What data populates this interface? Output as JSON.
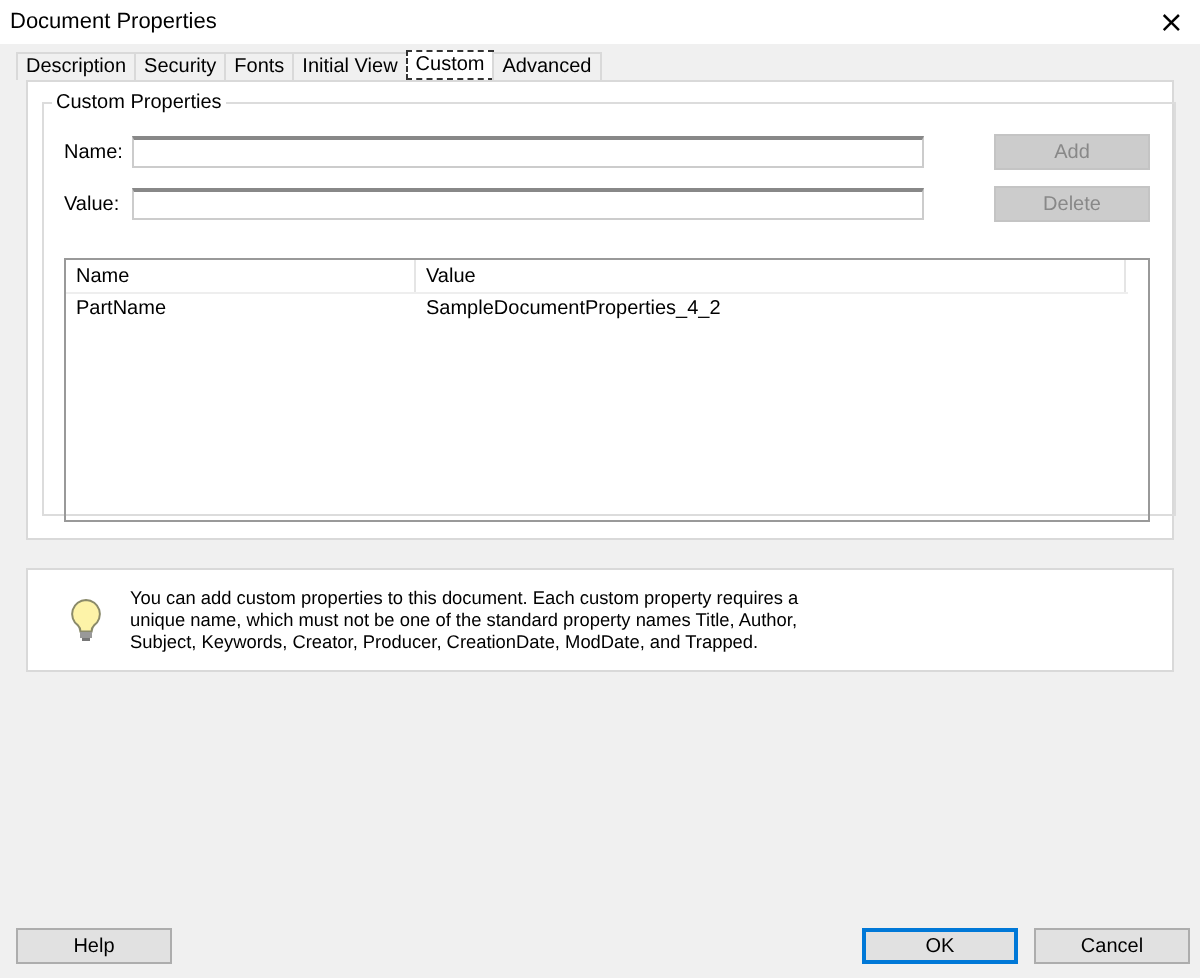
{
  "window": {
    "title": "Document Properties",
    "close": "×"
  },
  "tabs": [
    {
      "label": "Description",
      "selected": false
    },
    {
      "label": "Security",
      "selected": false
    },
    {
      "label": "Fonts",
      "selected": false
    },
    {
      "label": "Initial View",
      "selected": false
    },
    {
      "label": "Custom",
      "selected": true
    },
    {
      "label": "Advanced",
      "selected": false
    }
  ],
  "group": {
    "title": "Custom Properties",
    "fields": [
      {
        "label": "Name:",
        "button": "Add",
        "button_disabled": true
      },
      {
        "label": "Value:",
        "button": "Delete",
        "button_disabled": true
      }
    ]
  },
  "table": {
    "columns": [
      "Name",
      "Value"
    ],
    "rows": [
      [
        "PartName",
        "SampleDocumentProperties_4_2"
      ]
    ]
  },
  "info": "You can add custom properties to this document. Each custom property requires a unique name, which must not be one of the standard property names Title, Author, Subject, Keywords, Creator, Producer, CreationDate, ModDate, and Trapped.",
  "buttons": [
    {
      "label": "Help",
      "default": false
    },
    {
      "label": "OK",
      "default": true
    },
    {
      "label": "Cancel",
      "default": false
    }
  ]
}
